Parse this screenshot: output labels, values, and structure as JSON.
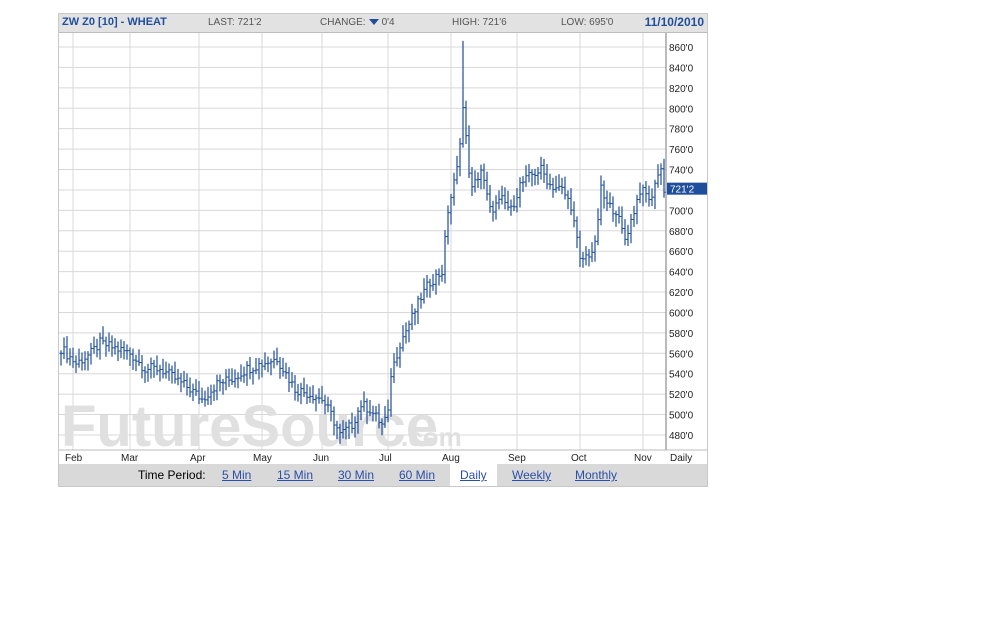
{
  "header": {
    "title": "ZW Z0 [10] - WHEAT",
    "last": "LAST: 721'2",
    "change_label": "CHANGE:",
    "change_value": "0'4",
    "change_direction": "down",
    "high": "HIGH: 721'6",
    "low": "LOW: 695'0",
    "date": "11/10/2010"
  },
  "colors": {
    "bar": "#1f4e9c",
    "grid": "#d8d8d8",
    "last_tag": "#1f4e9c",
    "watermark": "#e0e0e0"
  },
  "watermark": {
    "brand": "FutureSource",
    "suffix": ".com"
  },
  "time_period": {
    "label": "Time Period:",
    "options": [
      "5 Min",
      "15 Min",
      "30 Min",
      "60 Min",
      "Daily",
      "Weekly",
      "Monthly"
    ],
    "selected": "Daily"
  },
  "chart_data": {
    "type": "ohlc",
    "title": "ZW Z0 [10] - WHEAT",
    "period_label": "Daily",
    "ylim": [
      470,
      870
    ],
    "yticks": [
      480,
      500,
      520,
      540,
      560,
      580,
      600,
      620,
      640,
      660,
      680,
      700,
      720,
      740,
      760,
      780,
      800,
      820,
      840,
      860
    ],
    "ytick_labels": [
      "480'0",
      "500'0",
      "520'0",
      "540'0",
      "560'0",
      "580'0",
      "600'0",
      "620'0",
      "640'0",
      "660'0",
      "680'0",
      "700'0",
      "720'0",
      "740'0",
      "760'0",
      "780'0",
      "800'0",
      "820'0",
      "840'0",
      "860'0"
    ],
    "x_months": [
      {
        "label": "Feb",
        "bar": 4
      },
      {
        "label": "Mar",
        "bar": 23
      },
      {
        "label": "Apr",
        "bar": 46
      },
      {
        "label": "May",
        "bar": 67
      },
      {
        "label": "Jun",
        "bar": 87
      },
      {
        "label": "Jul",
        "bar": 109
      },
      {
        "label": "Aug",
        "bar": 130
      },
      {
        "label": "Sep",
        "bar": 152
      },
      {
        "label": "Oct",
        "bar": 173
      },
      {
        "label": "Nov",
        "bar": 194
      }
    ],
    "bar_count": 202,
    "close_anchors": [
      [
        0,
        565
      ],
      [
        5,
        550
      ],
      [
        10,
        560
      ],
      [
        13,
        570
      ],
      [
        18,
        565
      ],
      [
        23,
        560
      ],
      [
        28,
        545
      ],
      [
        33,
        545
      ],
      [
        38,
        535
      ],
      [
        43,
        525
      ],
      [
        47,
        515
      ],
      [
        52,
        530
      ],
      [
        57,
        535
      ],
      [
        62,
        545
      ],
      [
        67,
        550
      ],
      [
        72,
        555
      ],
      [
        75,
        540
      ],
      [
        78,
        525
      ],
      [
        83,
        520
      ],
      [
        87,
        515
      ],
      [
        90,
        500
      ],
      [
        93,
        480
      ],
      [
        97,
        490
      ],
      [
        100,
        510
      ],
      [
        103,
        505
      ],
      [
        107,
        490
      ],
      [
        109,
        500
      ],
      [
        110,
        540
      ],
      [
        113,
        570
      ],
      [
        117,
        595
      ],
      [
        120,
        615
      ],
      [
        123,
        630
      ],
      [
        127,
        640
      ],
      [
        129,
        700
      ],
      [
        132,
        740
      ],
      [
        134,
        800
      ],
      [
        136,
        740
      ],
      [
        137,
        720
      ],
      [
        140,
        740
      ],
      [
        143,
        700
      ],
      [
        147,
        710
      ],
      [
        150,
        700
      ],
      [
        153,
        725
      ],
      [
        157,
        735
      ],
      [
        160,
        740
      ],
      [
        163,
        725
      ],
      [
        167,
        720
      ],
      [
        170,
        705
      ],
      [
        172,
        670
      ],
      [
        173,
        650
      ],
      [
        177,
        660
      ],
      [
        178,
        665
      ],
      [
        180,
        720
      ],
      [
        182,
        705
      ],
      [
        185,
        700
      ],
      [
        187,
        680
      ],
      [
        188,
        672
      ],
      [
        190,
        690
      ],
      [
        193,
        720
      ],
      [
        197,
        710
      ],
      [
        198,
        730
      ],
      [
        200,
        740
      ],
      [
        201,
        721
      ]
    ],
    "spike": {
      "bar": 134,
      "high": 866
    },
    "last": {
      "value": 721.25,
      "label": "721'2"
    }
  }
}
